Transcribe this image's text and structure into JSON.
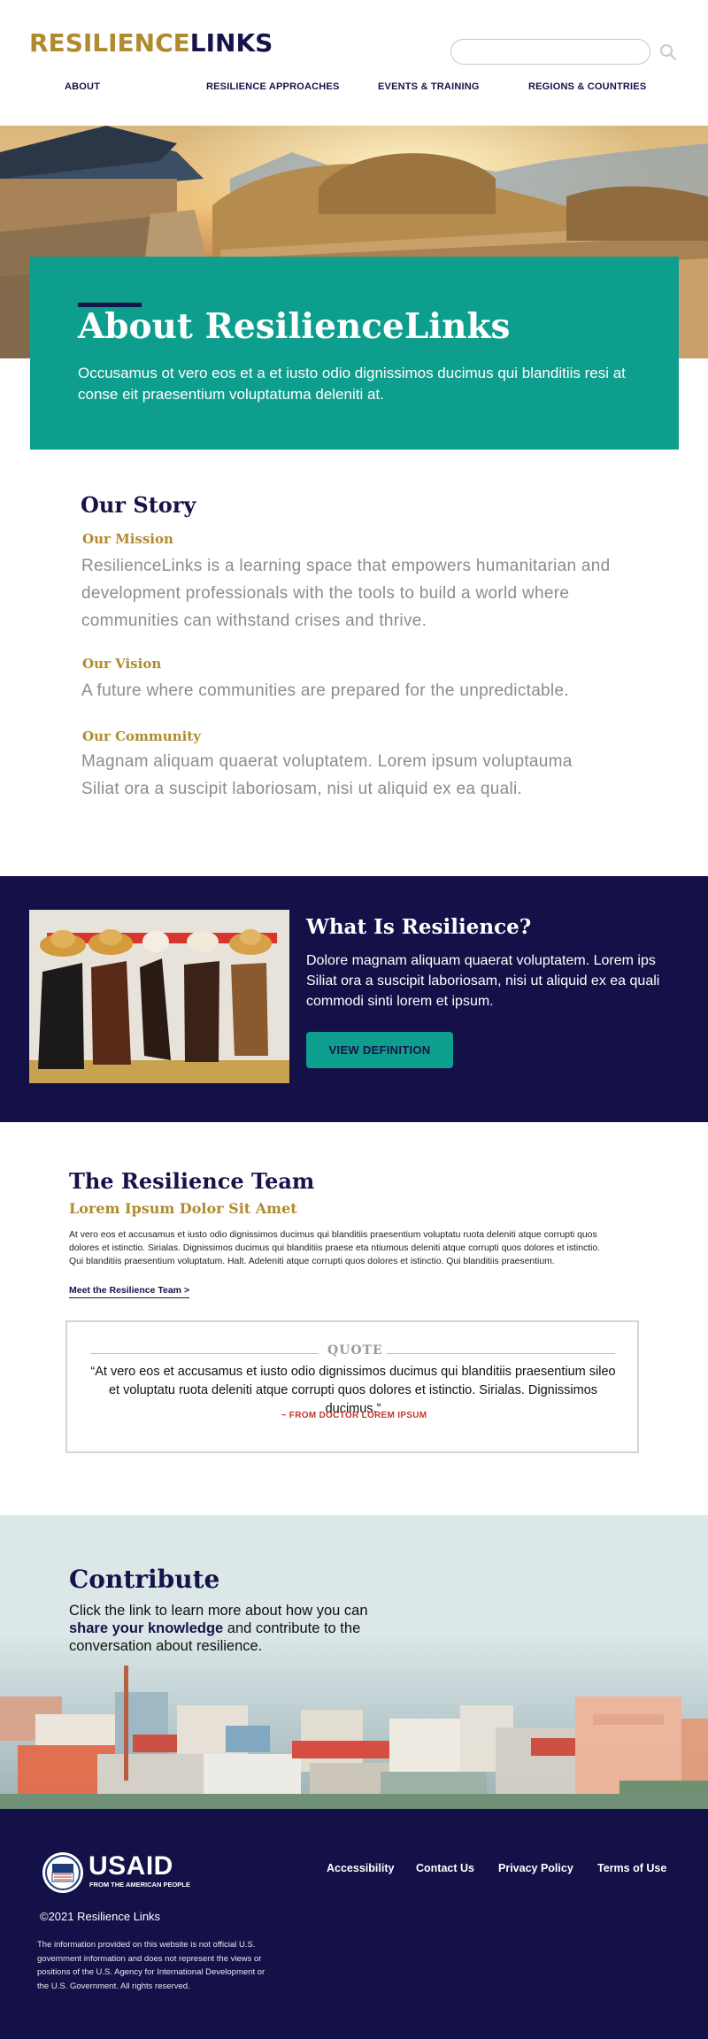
{
  "header": {
    "logo_part1": "RESILIENCE",
    "logo_part2": "LINKS",
    "search_placeholder": "",
    "nav": [
      "ABOUT",
      "RESILIENCE APPROACHES",
      "EVENTS & TRAINING",
      "REGIONS & COUNTRIES"
    ]
  },
  "hero": {
    "title": "About ResilienceLinks",
    "text": "Occusamus ot vero eos et a et iusto odio dignissimos ducimus qui blanditiis resi at conse eit praesentium voluptatuma deleniti at."
  },
  "story": {
    "heading": "Our Story",
    "mission_title": "Our Mission",
    "mission_text": "ResilienceLinks is a learning space that empowers humanitarian and development professionals with the tools to build a world where communities can withstand crises and thrive.",
    "vision_title": "Our Vision",
    "vision_text": "A future where communities are prepared for the unpredictable.",
    "community_title": "Our Community",
    "community_text": "Magnam aliquam quaerat voluptatem. Lorem ipsum voluptauma Siliat ora a suscipit laboriosam, nisi ut aliquid ex ea quali."
  },
  "resilience": {
    "heading": "What Is Resilience?",
    "text": "Dolore magnam aliquam quaerat voluptatem. Lorem ips Siliat ora a suscipit laboriosam, nisi ut aliquid ex ea quali commodi sinti lorem et ipsum.",
    "button": "VIEW DEFINITION"
  },
  "team": {
    "heading": "The Resilience Team",
    "subheading": "Lorem Ipsum Dolor Sit Amet",
    "text": "At vero eos et accusamus et iusto odio dignissimos ducimus qui blanditiis praesentium voluptatu ruota deleniti atque corrupti quos dolores et istinctio. Sirialas. Dignissimos ducimus qui blanditiis praese eta ntiumous deleniti atque corrupti quos dolores et istinctio. Qui blanditiis praesentium voluptatum. Halt. Adeleniti atque corrupti quos dolores et istinctio. Qui blanditiis praesentium.",
    "link": "Meet the Resilience Team >",
    "quote_label": "QUOTE",
    "quote_text": "“At vero eos et accusamus et iusto odio dignissimos ducimus qui blanditiis praesentium sileo et voluptatu ruota deleniti atque corrupti quos dolores et istinctio. Sirialas. Dignissimos ducimus.”",
    "quote_attribution": "~ FROM DOCTOR LOREM IPSUM"
  },
  "contribute": {
    "heading": "Contribute",
    "text_before": "Click the link to learn more about how you can ",
    "link": "share your knowledge",
    "text_after": "  and contribute to the conversation about resilience."
  },
  "footer": {
    "usaid_name": "USAID",
    "usaid_tagline": "FROM THE AMERICAN PEOPLE",
    "links": [
      "Accessibility",
      "Contact Us",
      "Privacy Policy",
      "Terms of Use"
    ],
    "copyright": "©2021 Resilience Links",
    "disclaimer": "The information provided on this website is not official U.S. government information and does not represent the views or positions of the U.S. Agency for International Development or the U.S. Government. All rights reserved."
  },
  "colors": {
    "navy": "#141048",
    "teal": "#0e9e8e",
    "gold": "#b08a2e",
    "quote_red": "#c0392b"
  }
}
